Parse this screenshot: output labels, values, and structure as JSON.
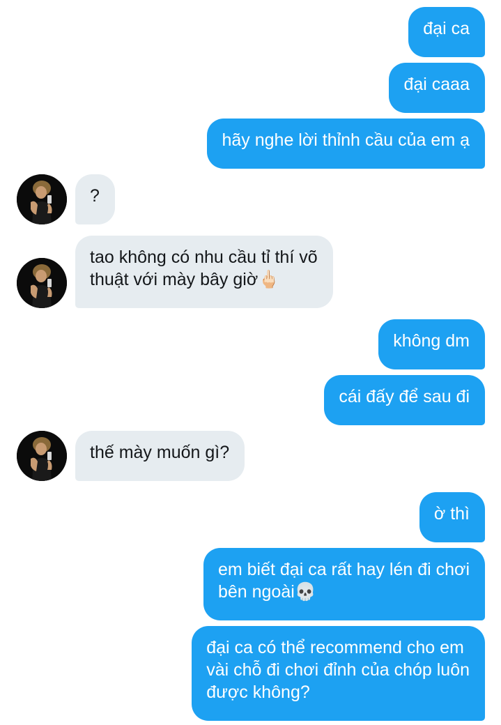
{
  "conversation": {
    "messages": [
      {
        "id": "m1",
        "sender": "me",
        "text": "đại ca"
      },
      {
        "id": "m2",
        "sender": "me",
        "text": "đại caaa"
      },
      {
        "id": "m3",
        "sender": "me",
        "text": "hãy nghe lời thỉnh cầu của em ạ"
      },
      {
        "id": "m4",
        "sender": "them",
        "text": "?"
      },
      {
        "id": "m5",
        "sender": "them",
        "text": "tao không có nhu cầu tỉ thí võ\nthuật với mày bây giờ🖕🏻"
      },
      {
        "id": "m6",
        "sender": "me",
        "text": "không dm"
      },
      {
        "id": "m7",
        "sender": "me",
        "text": "cái đấy để sau đi"
      },
      {
        "id": "m8",
        "sender": "them",
        "text": "thế mày muốn gì?"
      },
      {
        "id": "m9",
        "sender": "me",
        "text": "ờ thì"
      },
      {
        "id": "m10",
        "sender": "me",
        "text": "em biết đại ca rất hay lén đi chơi\nbên ngoài💀"
      },
      {
        "id": "m11",
        "sender": "me",
        "text": "đại ca có thể recommend cho em\nvài chỗ đi chơi đỉnh của chóp luôn\nđược không?"
      }
    ]
  },
  "colors": {
    "outgoing_bubble": "#1da1f2",
    "incoming_bubble": "#e6ecf0",
    "outgoing_text": "#ffffff",
    "incoming_text": "#14171a",
    "background": "#ffffff"
  },
  "icons": {
    "avatar": "avatar-photo-icon"
  }
}
